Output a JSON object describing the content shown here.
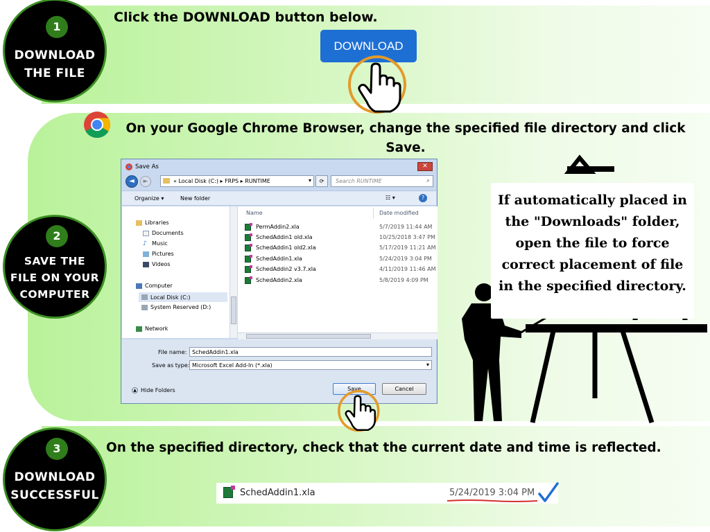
{
  "step1": {
    "number": "1",
    "label": "DOWNLOAD\nTHE FILE",
    "heading": "Click the DOWNLOAD button below.",
    "button_label": "DOWNLOAD"
  },
  "step2": {
    "number": "2",
    "label": "SAVE THE\nFILE ON YOUR\nCOMPUTER",
    "heading": "On your Google Chrome Browser, change the specified file directory and click Save.",
    "note": "If automatically placed in\nthe \"Downloads\" folder,\nopen the file to force\ncorrect placement of file\nin the specified directory."
  },
  "step3": {
    "number": "3",
    "label": "DOWNLOAD\nSUCCESSFUL",
    "heading": "On the specified directory, check that the current date and time is reflected.",
    "file_name": "SchedAddin1.xla",
    "file_date": "5/24/2019 3:04 PM"
  },
  "dialog": {
    "title": "Save As",
    "close_label": "✕",
    "address_path": "« Local Disk (C:) ▸ FRPS ▸ RUNTIME",
    "search_placeholder": "Search RUNTIME",
    "organize_label": "Organize ▾",
    "new_folder_label": "New folder",
    "view_label": "☷ ▾",
    "help_label": "?",
    "nav_items": [
      {
        "label": "Libraries",
        "icon": "library-icon"
      },
      {
        "label": "Documents",
        "icon": "documents-icon"
      },
      {
        "label": "Music",
        "icon": "music-icon"
      },
      {
        "label": "Pictures",
        "icon": "pictures-icon"
      },
      {
        "label": "Videos",
        "icon": "videos-icon"
      },
      {
        "label": "Computer",
        "icon": "computer-icon"
      },
      {
        "label": "Local Disk (C:)",
        "icon": "drive-icon"
      },
      {
        "label": "System Reserved (D:)",
        "icon": "drive-icon"
      },
      {
        "label": "Network",
        "icon": "network-icon"
      }
    ],
    "columns": {
      "name": "Name",
      "date": "Date modified"
    },
    "files": [
      {
        "name": "PermAddin2.xla",
        "date": "5/7/2019 11:44 AM"
      },
      {
        "name": "SchedAddin1 old.xla",
        "date": "10/25/2018 3:47 PM"
      },
      {
        "name": "SchedAddin1 old2.xla",
        "date": "5/17/2019 11:21 AM"
      },
      {
        "name": "SchedAddin1.xla",
        "date": "5/24/2019 3:04 PM"
      },
      {
        "name": "SchedAddin2 v3.7.xla",
        "date": "4/11/2019 11:46 AM"
      },
      {
        "name": "SchedAddin2.xla",
        "date": "5/8/2019 4:09 PM"
      }
    ],
    "file_name_label": "File name:",
    "file_name_value": "SchedAddin1.xla",
    "save_type_label": "Save as type:",
    "save_type_value": "Microsoft Excel Add-In (*.xla)",
    "hide_folders_label": "Hide Folders",
    "save_label": "Save",
    "cancel_label": "Cancel"
  },
  "colors": {
    "accent_green": "#2f7d1b",
    "download_blue": "#1e6fd4",
    "hand_ring": "#e39a2a",
    "check_blue": "#1e6fd4",
    "underline_red": "#d0312d"
  }
}
